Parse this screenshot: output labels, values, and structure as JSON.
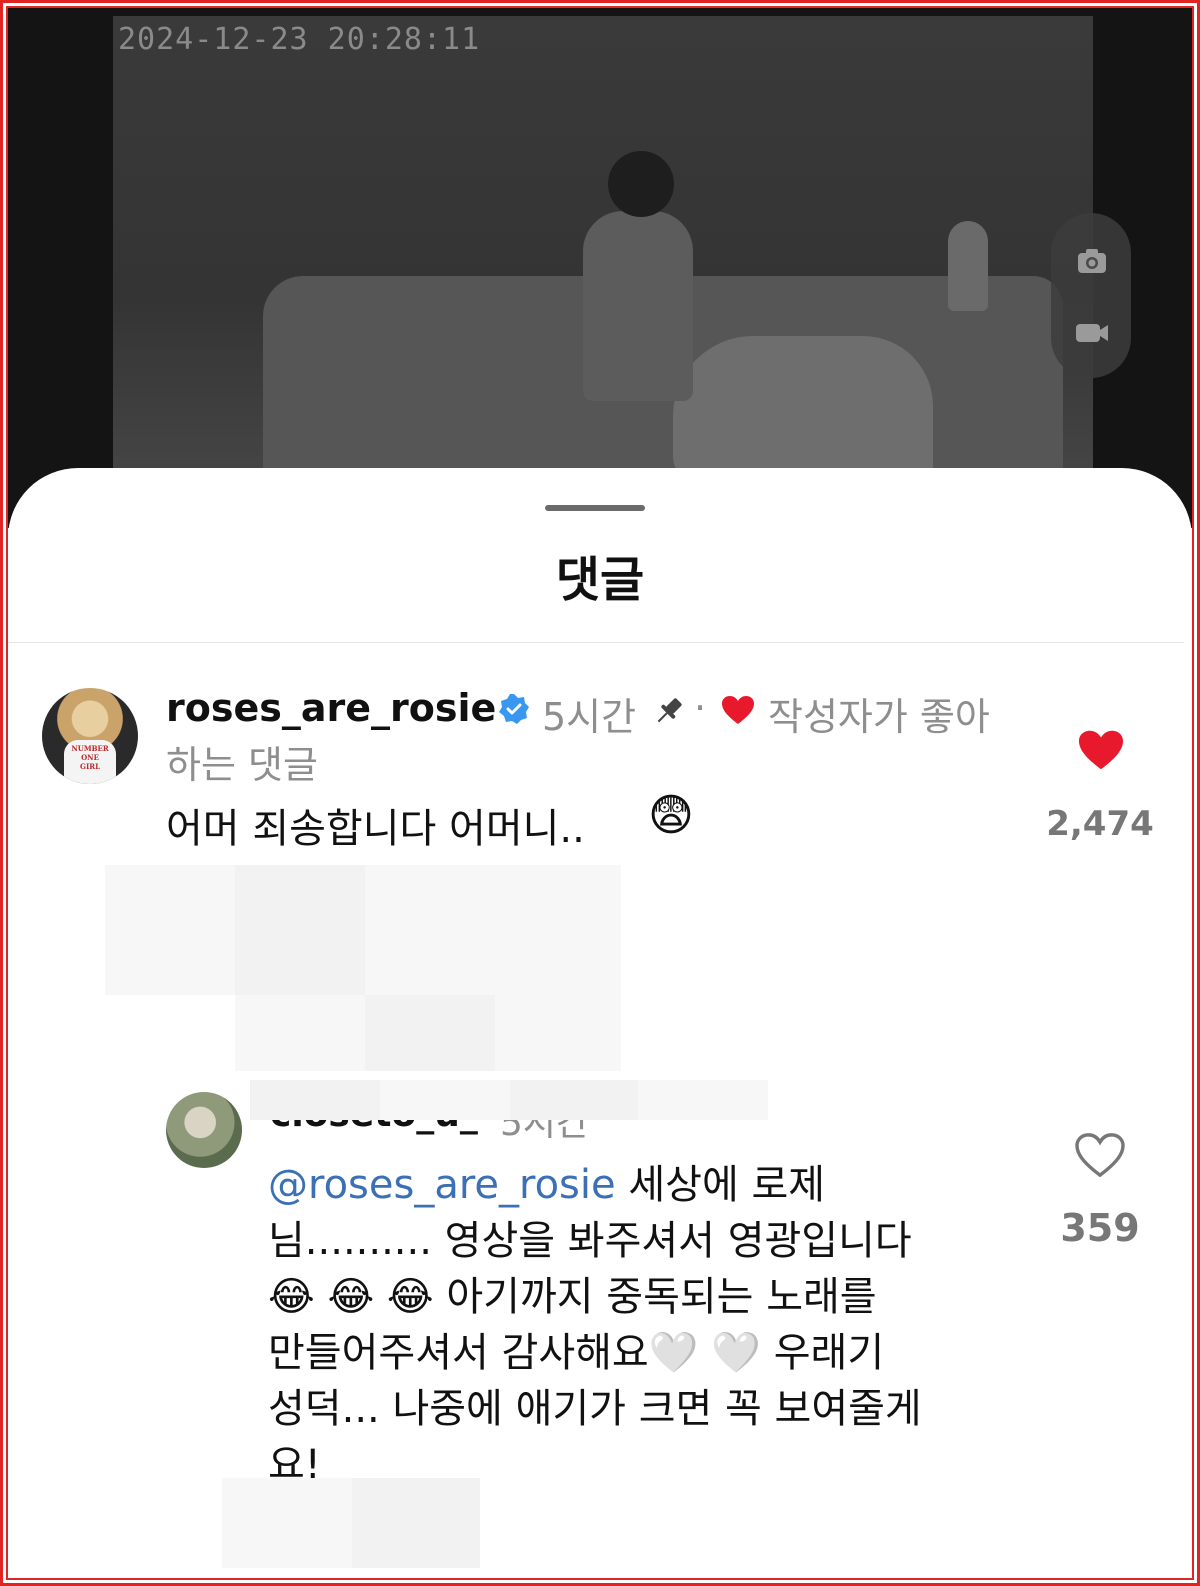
{
  "video": {
    "timestamp": "2024-12-23  20:28:11",
    "controls": {
      "camera_icon": "camera-icon",
      "record_icon": "video-record-icon"
    }
  },
  "sheet": {
    "title": "댓글"
  },
  "comments": [
    {
      "username": "roses_are_rosie",
      "verified": true,
      "time": "5시간",
      "pinned": true,
      "separator": "·",
      "liked_by_author_label": "작성자가 좋아하는 댓글",
      "liked_by_author_line1": "작성자가 좋아",
      "liked_by_author_line2": "하는 댓글",
      "text": "어머 죄송합니다 어머니..",
      "emoji": "😨",
      "like_count": "2,474",
      "liked": true,
      "avatar_shirt_text": "NUMBER ONE GIRL"
    },
    {
      "username": "closeto_u_",
      "time": "5시간",
      "mention": "@roses_are_rosie",
      "text_line1": " 세상에 로제",
      "text_line2": "님.......... 영상을 봐주셔서 영광입니다",
      "text_line3_emoji": "😂 😂 😂",
      "text_line3": " 아기까지 중독되는 노래를",
      "text_line4": "만들어주셔서 감사해요🤍 🤍  우래기",
      "text_line5": "성덕... 나중에 애기가 크면 꼭 보여줄게",
      "text_line6": "요!",
      "like_count": "359",
      "liked": false
    }
  ],
  "colors": {
    "heart_red": "#e8192c",
    "mention_blue": "#3b6fb6",
    "verified_blue": "#3897f0",
    "frame_red": "#e02424"
  }
}
